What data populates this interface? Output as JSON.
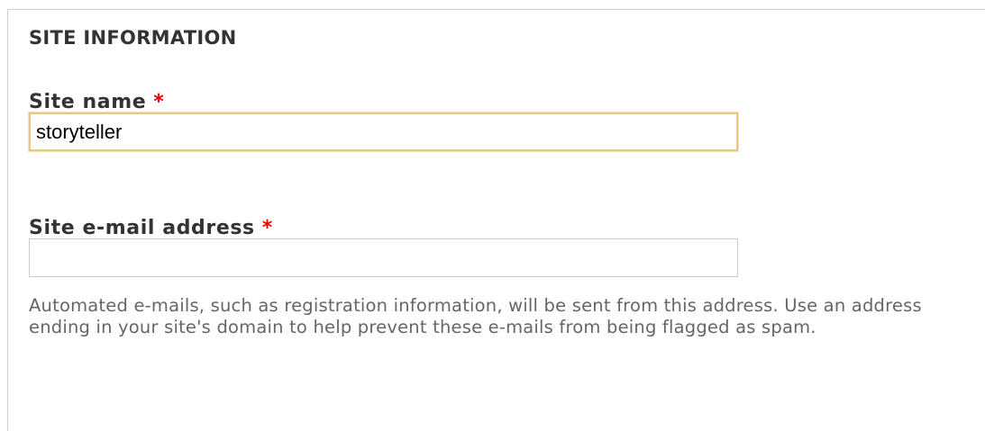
{
  "fieldset": {
    "legend": "SITE INFORMATION"
  },
  "site_name": {
    "label": "Site name",
    "required_marker": "*",
    "value": "storyteller"
  },
  "site_email": {
    "label": "Site e-mail address",
    "required_marker": "*",
    "value": "",
    "description": "Automated e-mails, such as registration information, will be sent from this address. Use an address ending in your site's domain to help prevent these e-mails from being flagged as spam."
  },
  "colors": {
    "required": "#ee0000",
    "focus_border": "#e5c984",
    "label_text": "#333333",
    "description_text": "#666666",
    "fieldset_border": "#cfcfcf"
  }
}
